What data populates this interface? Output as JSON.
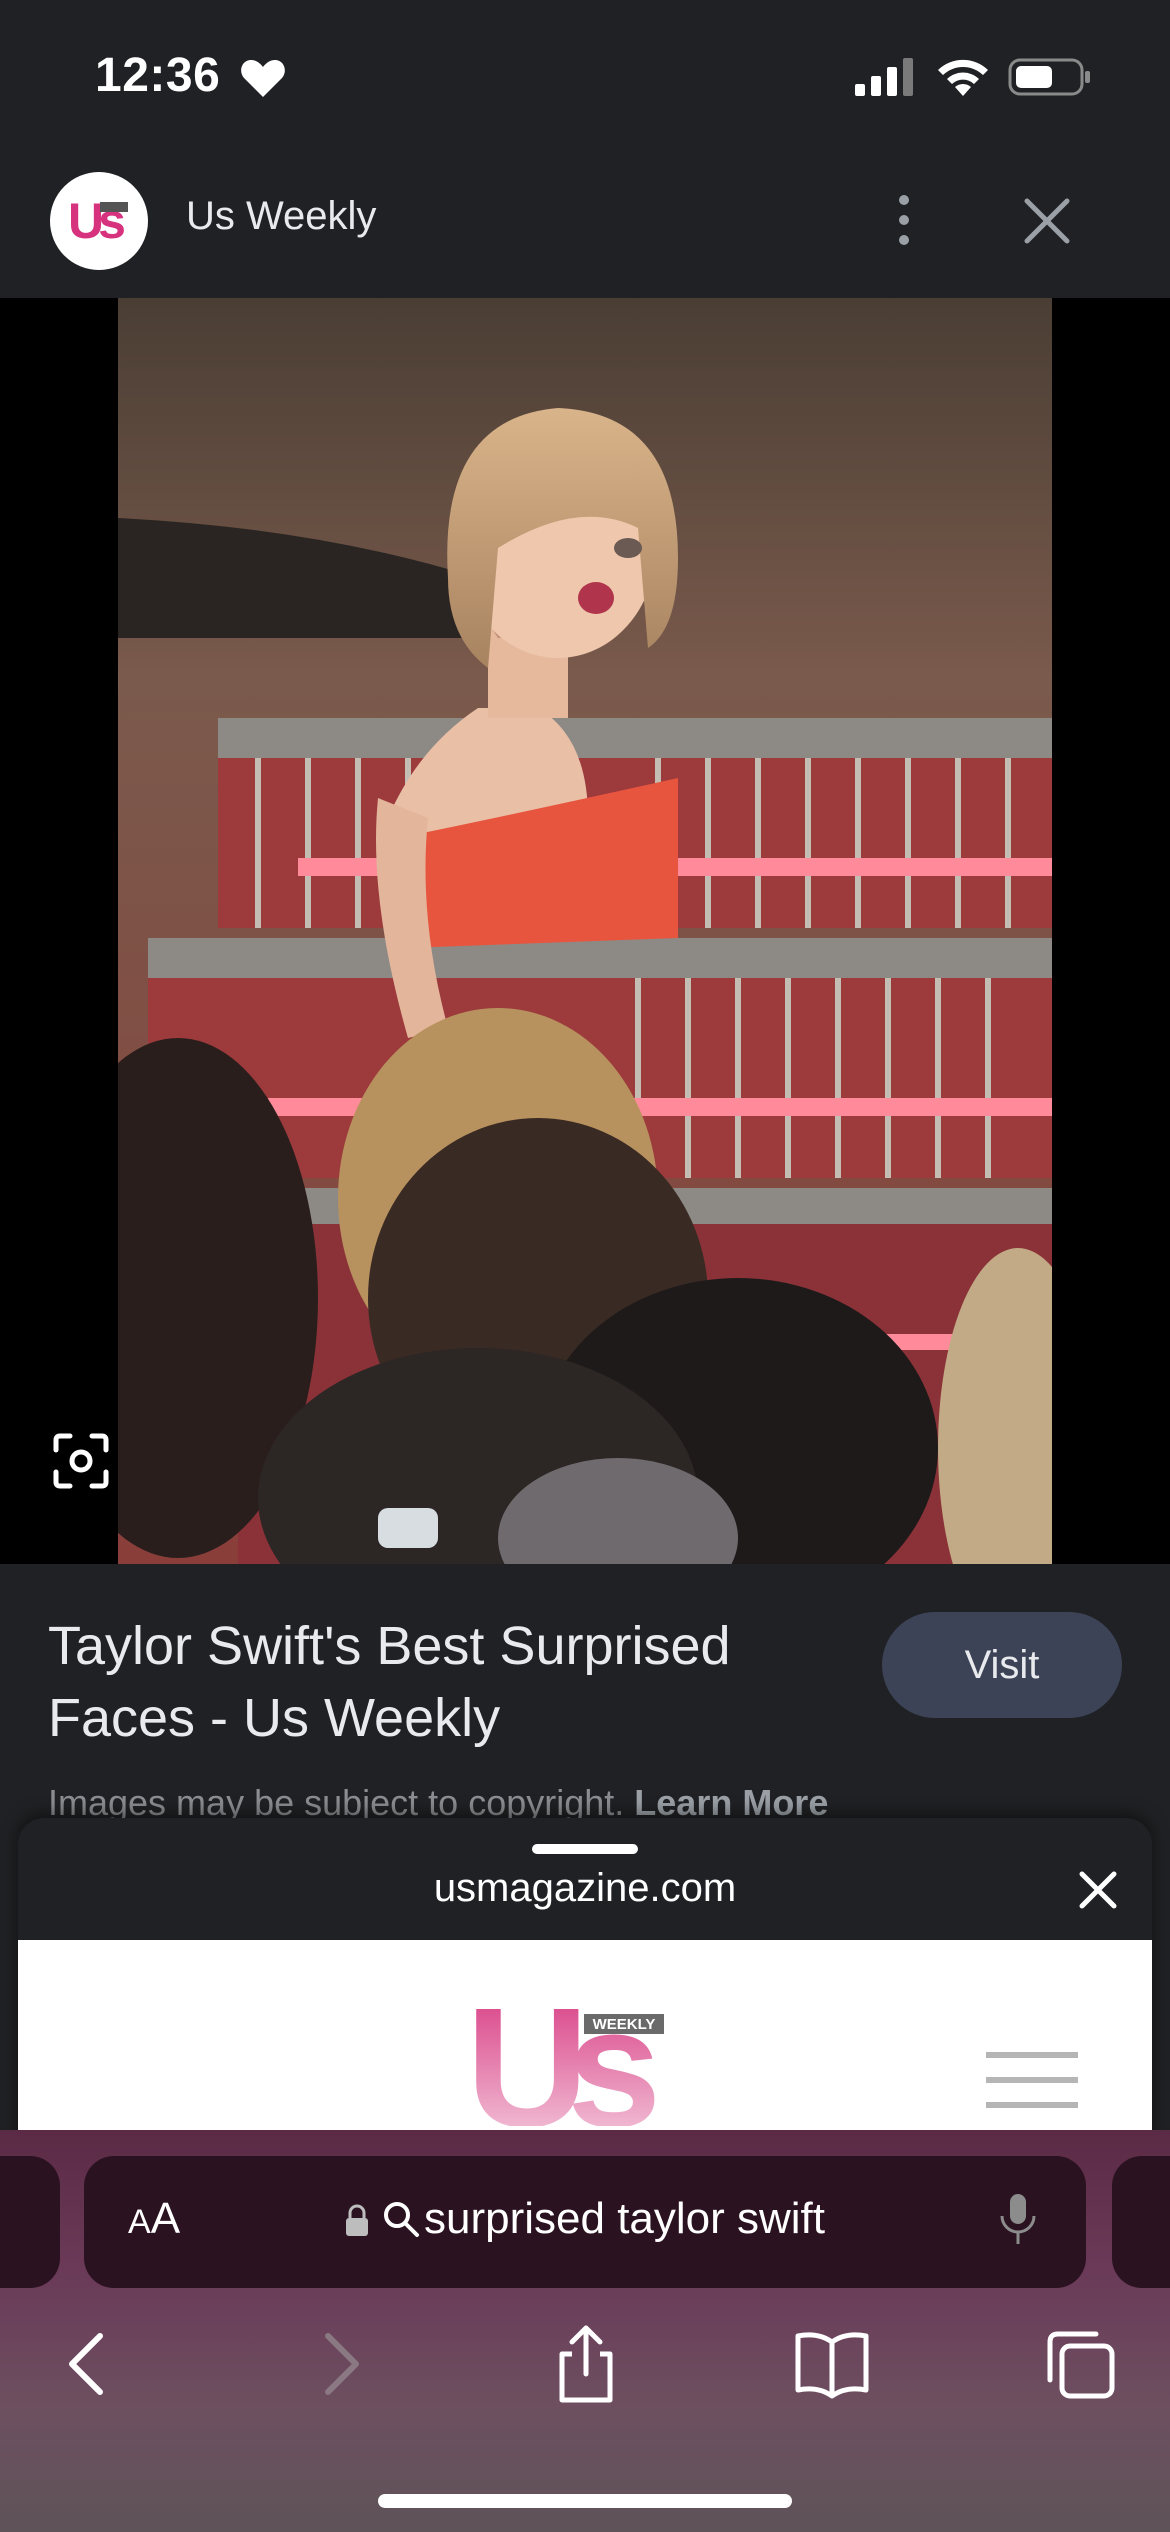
{
  "status_bar": {
    "time": "12:36"
  },
  "header": {
    "site_name": "Us Weekly",
    "logo_text": "Us"
  },
  "result": {
    "title": "Taylor Swift's Best Surprised Faces - Us Weekly",
    "visit_label": "Visit",
    "copyright_text": "Images may be subject to copyright.",
    "learn_more_label": "Learn More"
  },
  "sheet": {
    "domain": "usmagazine.com",
    "preview_logo_text": "Us",
    "preview_logo_badge": "WEEKLY"
  },
  "address_bar": {
    "text_size_small": "A",
    "text_size_large": "A",
    "query": "surprised taylor swift"
  },
  "colors": {
    "background": "#202124",
    "visit_button": "#3c4356",
    "logo_pink": "#d6327d",
    "toolbar_tint": "#5b2a45"
  }
}
